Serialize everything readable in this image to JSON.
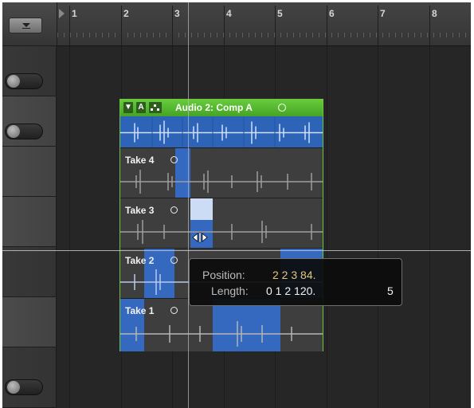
{
  "ruler": {
    "bars": [
      "1",
      "2",
      "3",
      "4",
      "5",
      "6",
      "7",
      "8"
    ]
  },
  "comp_region": {
    "header_buttons": [
      "▼",
      "A"
    ],
    "title": "Audio 2: Comp A",
    "color": "#55b82f"
  },
  "takes": [
    {
      "label": "Take 4"
    },
    {
      "label": "Take 3"
    },
    {
      "label": "Take 2"
    },
    {
      "label": "Take 1"
    }
  ],
  "tooltip": {
    "position_label": "Position:",
    "position_value": "2 2 3 84.",
    "length_label": "Length:",
    "length_value": "0 1 2 120.",
    "length_extra": "5"
  },
  "colors": {
    "selection": "#3569bf",
    "region_border": "#6fc43f",
    "position_text": "#e2c57f"
  },
  "icons": [
    "track-menu-icon",
    "playhead-marker-icon",
    "disclosure-triangle-icon",
    "group-icon",
    "resize-cursor-icon"
  ]
}
